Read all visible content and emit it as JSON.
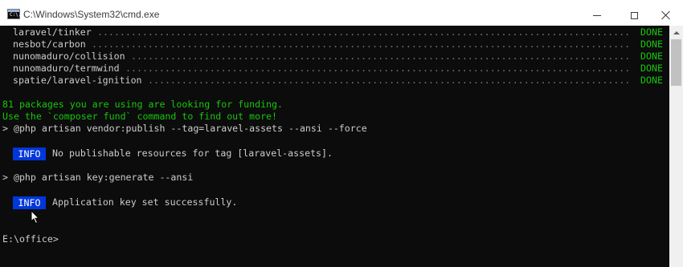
{
  "window": {
    "title": "C:\\Windows\\System32\\cmd.exe",
    "app_icon": "cmd-icon",
    "app_icon_glyph": "C:\\.",
    "controls": [
      "minimize-icon",
      "maximize-icon",
      "close-icon"
    ]
  },
  "console": {
    "packages": [
      {
        "name": "laravel/tinker",
        "status": "DONE"
      },
      {
        "name": "nesbot/carbon",
        "status": "DONE"
      },
      {
        "name": "nunomaduro/collision",
        "status": "DONE"
      },
      {
        "name": "nunomaduro/termwind",
        "status": "DONE"
      },
      {
        "name": "spatie/laravel-ignition",
        "status": "DONE"
      }
    ],
    "funding_line1": "81 packages you are using are looking for funding.",
    "funding_line2": "Use the `composer fund` command to find out more!",
    "command1": "> @php artisan vendor:publish --tag=laravel-assets --ansi --force",
    "info1_badge": "INFO",
    "info1_text": "No publishable resources for tag [laravel-assets].",
    "command2": "> @php artisan key:generate --ansi",
    "info2_badge": "INFO",
    "info2_text": "Application key set successfully.",
    "prompt": "E:\\office>"
  },
  "colors": {
    "console_bg": "#0c0c0c",
    "text": "#cccccc",
    "green": "#16c60c",
    "info_bg": "#0037da",
    "dots": "#767676"
  }
}
